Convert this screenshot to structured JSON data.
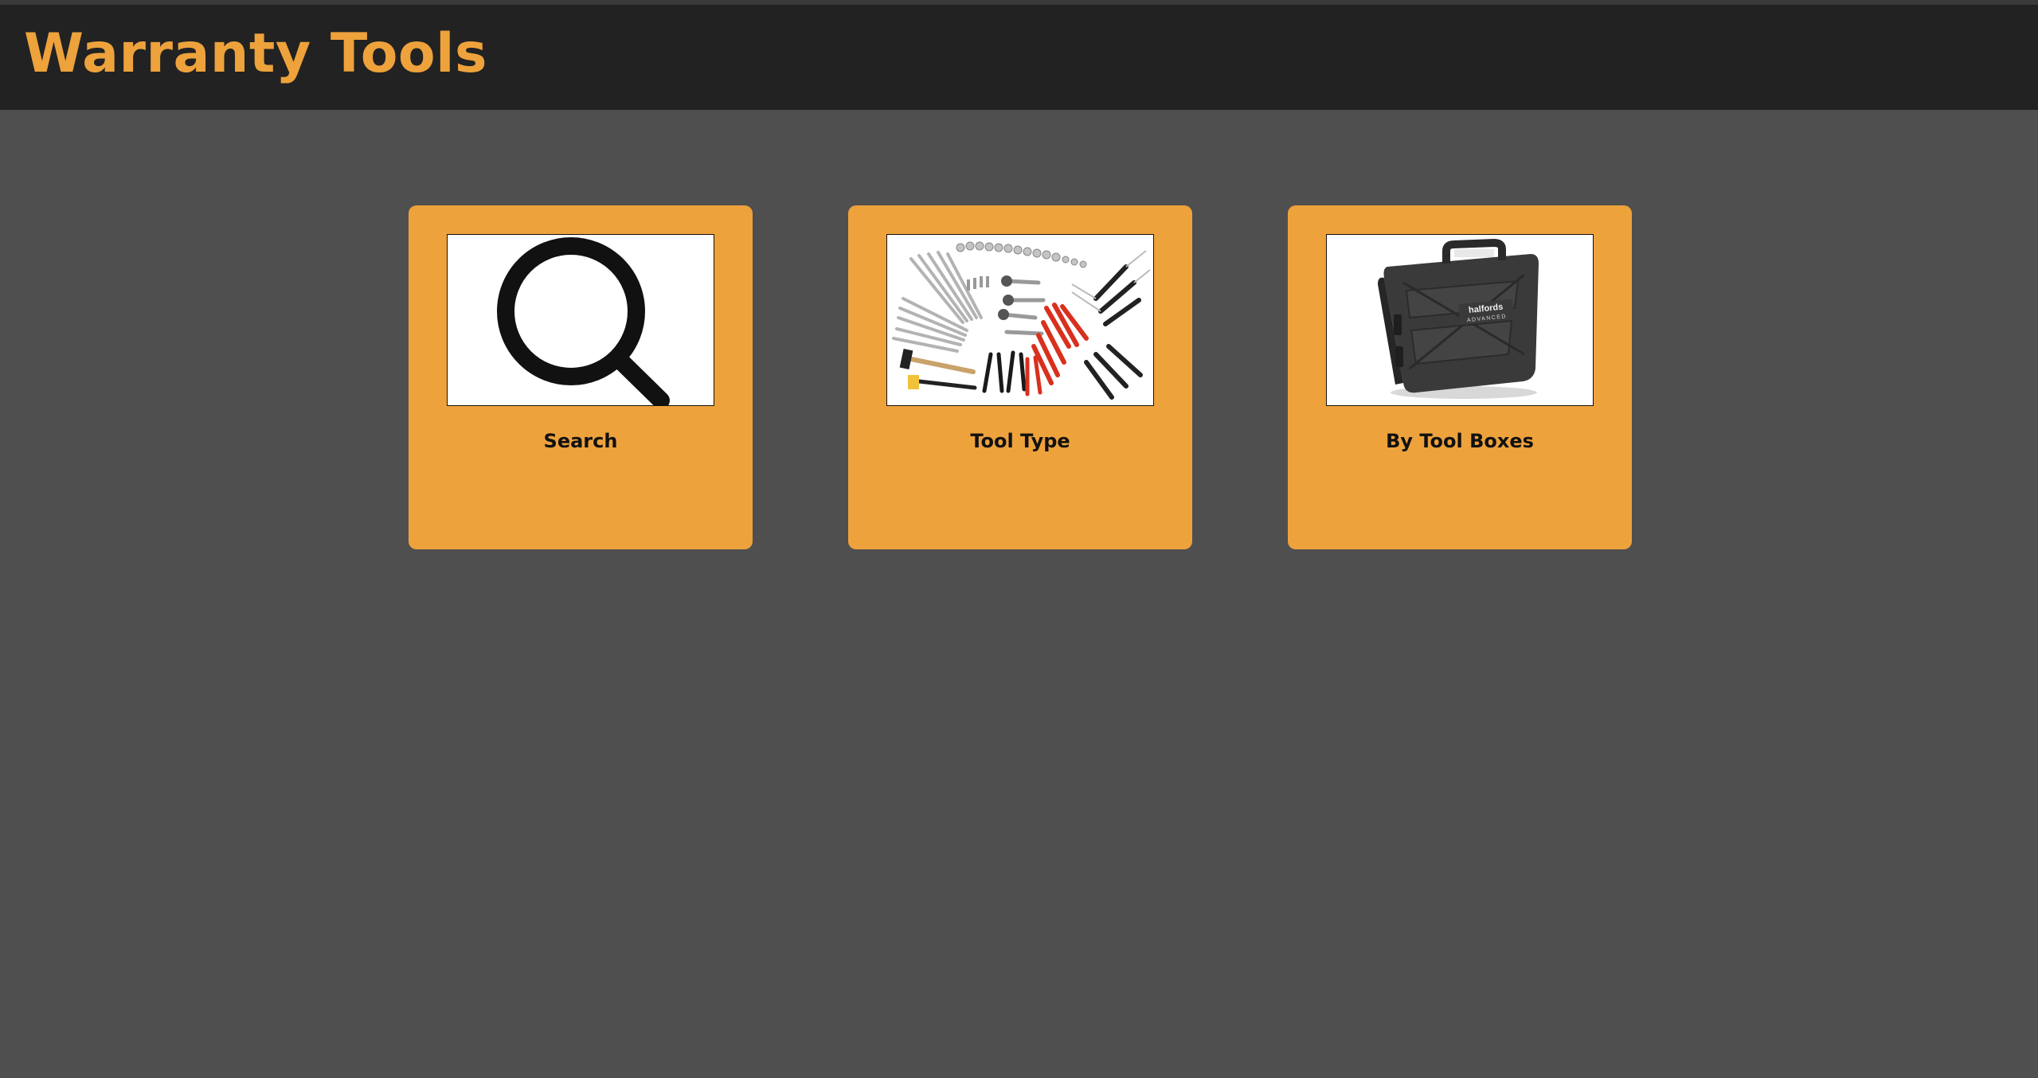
{
  "header": {
    "title": "Warranty Tools"
  },
  "colors": {
    "accent": "#eea23c",
    "header_bg": "#222222",
    "page_bg": "#4f4f4f"
  },
  "cards": [
    {
      "label": "Search",
      "icon": "magnifier-icon"
    },
    {
      "label": "Tool Type",
      "icon": "tool-set-image"
    },
    {
      "label": "By Tool Boxes",
      "icon": "tool-box-image"
    }
  ],
  "toolbox_brand": {
    "line1": "halfords",
    "line2": "ADVANCED"
  }
}
